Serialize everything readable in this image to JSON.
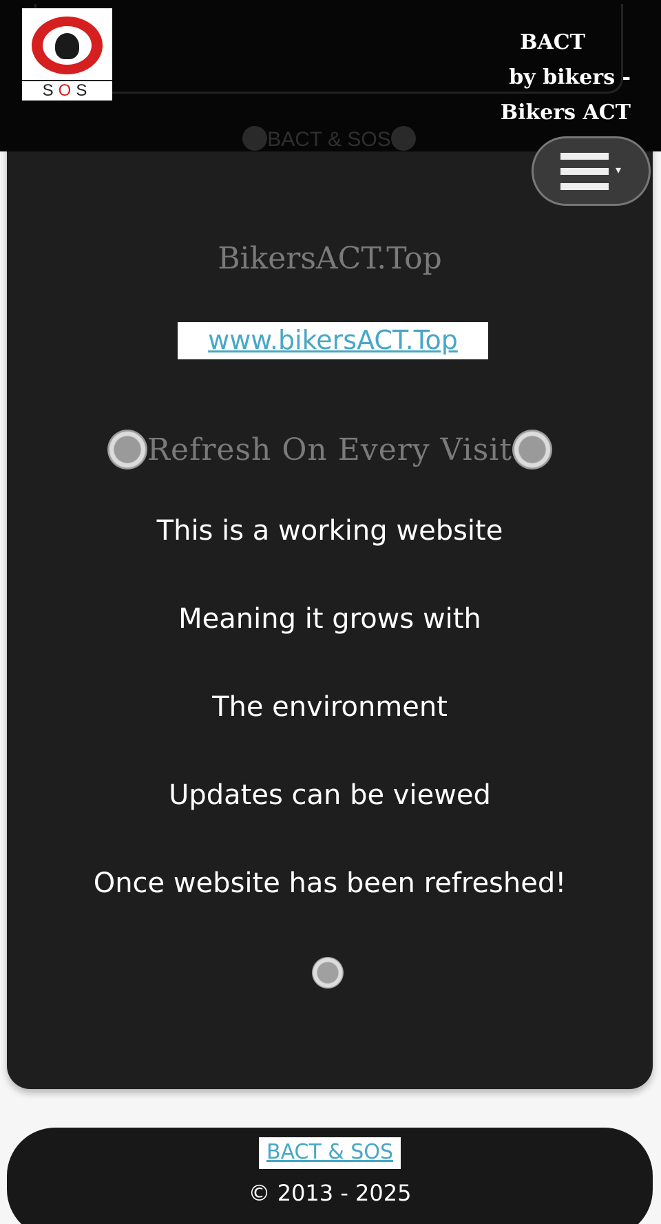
{
  "header": {
    "logo_text": "SOS",
    "title_line1": "BACT",
    "title_line2": "by bikers -",
    "title_line3": "Bikers ACT",
    "subtitle": "BACT & SOS"
  },
  "menu": {
    "icon": "hamburger-icon",
    "caret": "▾"
  },
  "main": {
    "site_name": "BikersACT.Top",
    "site_link": "www.bikersACT.Top",
    "refresh_heading": "Refresh On Every Visit",
    "lines": [
      "This is a working website",
      "Meaning it grows with",
      "The environment",
      "Updates can be viewed",
      "Once website has been refreshed!"
    ]
  },
  "footer": {
    "link": "BACT & SOS",
    "copyright": "© 2013 - 2025"
  },
  "colors": {
    "header_bg": "#060606",
    "card_bg": "#1e1e1e",
    "link": "#48a7c8",
    "muted_heading": "#7a7a7a",
    "logo_red": "#d61f1f"
  }
}
